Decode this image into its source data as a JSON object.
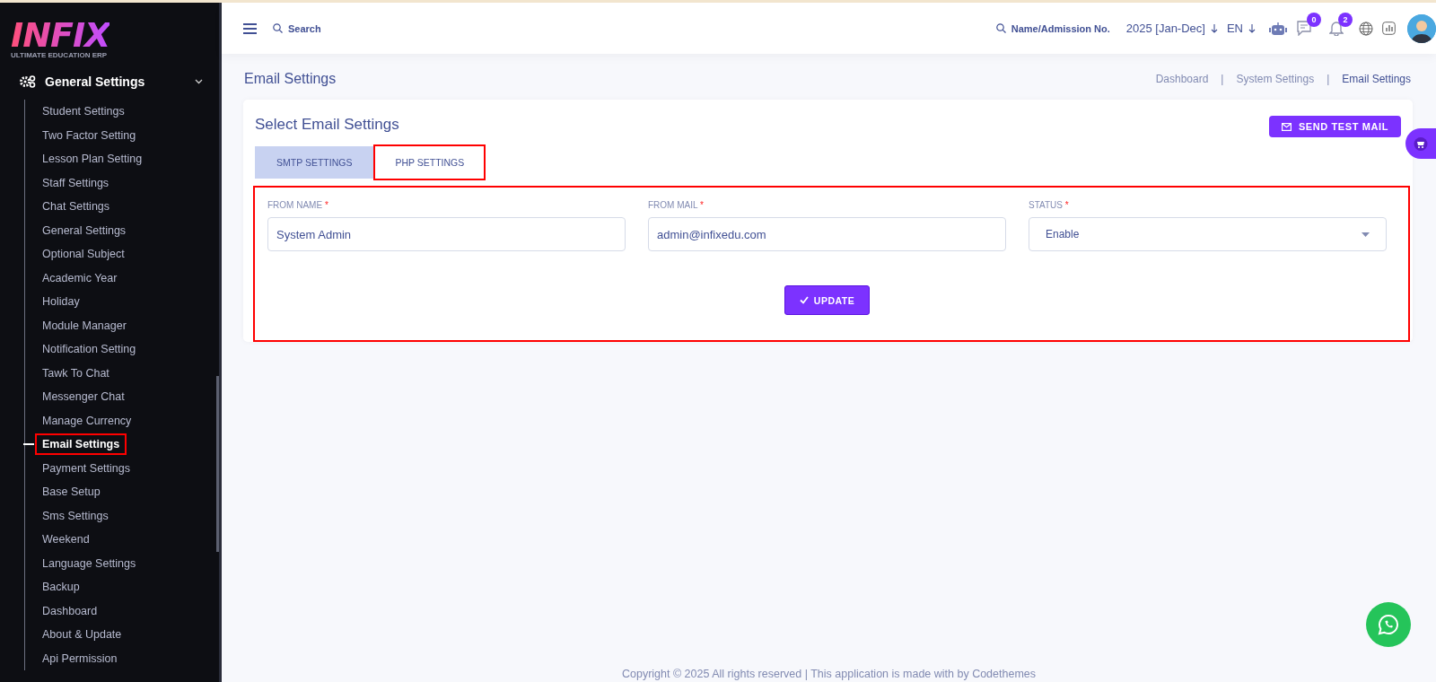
{
  "logo": {
    "name": "INFIX",
    "tagline": "ULTIMATE EDUCATION ERP"
  },
  "sidebar": {
    "group": {
      "label": "General Settings",
      "expanded": true,
      "items": [
        {
          "label": "Student Settings",
          "selected": false,
          "annotated": false
        },
        {
          "label": "Two Factor Setting",
          "selected": false,
          "annotated": false
        },
        {
          "label": "Lesson Plan Setting",
          "selected": false,
          "annotated": false
        },
        {
          "label": "Staff Settings",
          "selected": false,
          "annotated": false
        },
        {
          "label": "Chat Settings",
          "selected": false,
          "annotated": false
        },
        {
          "label": "General Settings",
          "selected": false,
          "annotated": false
        },
        {
          "label": "Optional Subject",
          "selected": false,
          "annotated": false
        },
        {
          "label": "Academic Year",
          "selected": false,
          "annotated": false
        },
        {
          "label": "Holiday",
          "selected": false,
          "annotated": false
        },
        {
          "label": "Module Manager",
          "selected": false,
          "annotated": false
        },
        {
          "label": "Notification Setting",
          "selected": false,
          "annotated": false
        },
        {
          "label": "Tawk To Chat",
          "selected": false,
          "annotated": false
        },
        {
          "label": "Messenger Chat",
          "selected": false,
          "annotated": false
        },
        {
          "label": "Manage Currency",
          "selected": false,
          "annotated": false
        },
        {
          "label": "Email Settings",
          "selected": true,
          "annotated": true
        },
        {
          "label": "Payment Settings",
          "selected": false,
          "annotated": false
        },
        {
          "label": "Base Setup",
          "selected": false,
          "annotated": false
        },
        {
          "label": "Sms Settings",
          "selected": false,
          "annotated": false
        },
        {
          "label": "Weekend",
          "selected": false,
          "annotated": false
        },
        {
          "label": "Language Settings",
          "selected": false,
          "annotated": false
        },
        {
          "label": "Backup",
          "selected": false,
          "annotated": false
        },
        {
          "label": "Dashboard",
          "selected": false,
          "annotated": false
        },
        {
          "label": "About & Update",
          "selected": false,
          "annotated": false
        },
        {
          "label": "Api Permission",
          "selected": false,
          "annotated": false
        }
      ]
    }
  },
  "header": {
    "search": {
      "placeholder": "Search"
    },
    "student_search": {
      "placeholder": "Name/Admission No."
    },
    "session": "2025 [Jan-Dec]",
    "language": "EN",
    "messages_badge": "0",
    "notifications_badge": "2"
  },
  "page": {
    "title": "Email Settings",
    "breadcrumbs": [
      {
        "kind": "link",
        "text": "Dashboard"
      },
      {
        "kind": "separator",
        "text": "|"
      },
      {
        "kind": "link",
        "text": "System Settings"
      },
      {
        "kind": "separator",
        "text": "|"
      },
      {
        "kind": "link",
        "text": "Email Settings"
      }
    ]
  },
  "card": {
    "title": "Select Email Settings",
    "test_button": "SEND TEST MAIL",
    "tabs": [
      {
        "label": "SMTP SETTINGS",
        "selected": true,
        "annotated": false
      },
      {
        "label": "PHP SETTINGS",
        "selected": false,
        "annotated": true
      }
    ],
    "form": {
      "annotated": true,
      "fields": [
        {
          "kind": "text",
          "label": "FROM NAME",
          "required_mark": "*",
          "value": "System Admin"
        },
        {
          "kind": "text",
          "label": "FROM MAIL",
          "required_mark": "*",
          "value": "admin@infixedu.com"
        },
        {
          "kind": "select",
          "label": "STATUS",
          "required_mark": "*",
          "value": "Enable"
        }
      ],
      "submit": "UPDATE"
    }
  },
  "footer": "Copyright © 2025 All rights reserved | This application is made with by Codethemes"
}
